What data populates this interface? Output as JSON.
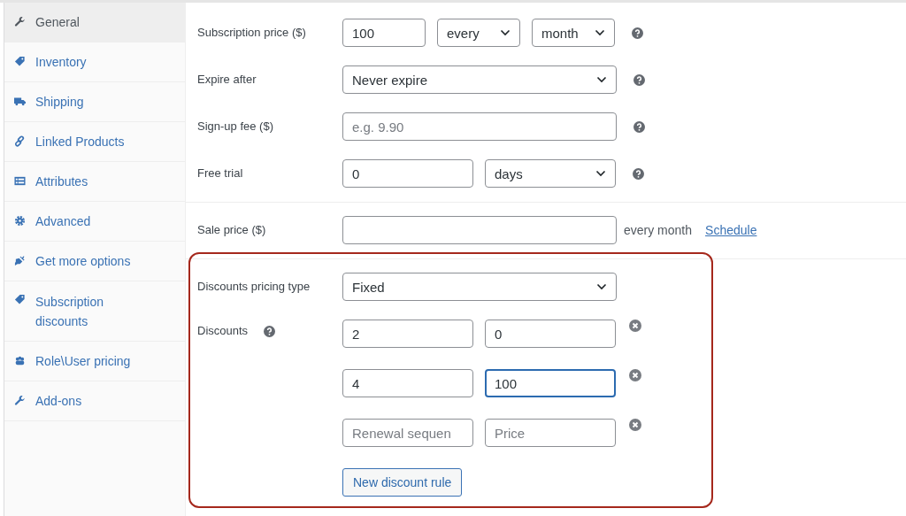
{
  "sidebar": {
    "items": [
      {
        "label": "General",
        "selected": true
      },
      {
        "label": "Inventory",
        "selected": false
      },
      {
        "label": "Shipping",
        "selected": false
      },
      {
        "label": "Linked Products",
        "selected": false
      },
      {
        "label": "Attributes",
        "selected": false
      },
      {
        "label": "Advanced",
        "selected": false
      },
      {
        "label": "Get more options",
        "selected": false
      },
      {
        "label": "Subscription discounts",
        "selected": false
      },
      {
        "label": "Role\\User pricing",
        "selected": false
      },
      {
        "label": "Add-ons",
        "selected": false
      }
    ]
  },
  "subscription_fields": [
    {
      "label": "Subscription price ($)",
      "controls": [
        {
          "kind": "input",
          "value": "100"
        },
        {
          "kind": "select",
          "value": "every"
        },
        {
          "kind": "select",
          "value": "month"
        }
      ]
    },
    {
      "label": "Expire after",
      "controls": [
        {
          "kind": "select",
          "value": "Never expire"
        }
      ]
    },
    {
      "label": "Sign-up fee ($)",
      "controls": [
        {
          "kind": "input",
          "placeholder": "e.g. 9.90"
        }
      ]
    },
    {
      "label": "Free trial",
      "controls": [
        {
          "kind": "input",
          "value": "0"
        },
        {
          "kind": "select",
          "value": "days"
        }
      ]
    }
  ],
  "sale_price": {
    "label": "Sale price ($)",
    "suffix": "every month",
    "link": "Schedule"
  },
  "discounts": {
    "pricing_type": {
      "label": "Discounts pricing type",
      "value": "Fixed"
    },
    "label": "Discounts",
    "rules": [
      {
        "sequence": {
          "value": "2"
        },
        "price": {
          "value": "0",
          "focused": false
        }
      },
      {
        "sequence": {
          "value": "4"
        },
        "price": {
          "value": "100",
          "focused": true
        }
      },
      {
        "sequence": {
          "placeholder": "Renewal sequen"
        },
        "price": {
          "placeholder": "Price",
          "focused": false
        }
      }
    ],
    "button": "New discount rule"
  }
}
